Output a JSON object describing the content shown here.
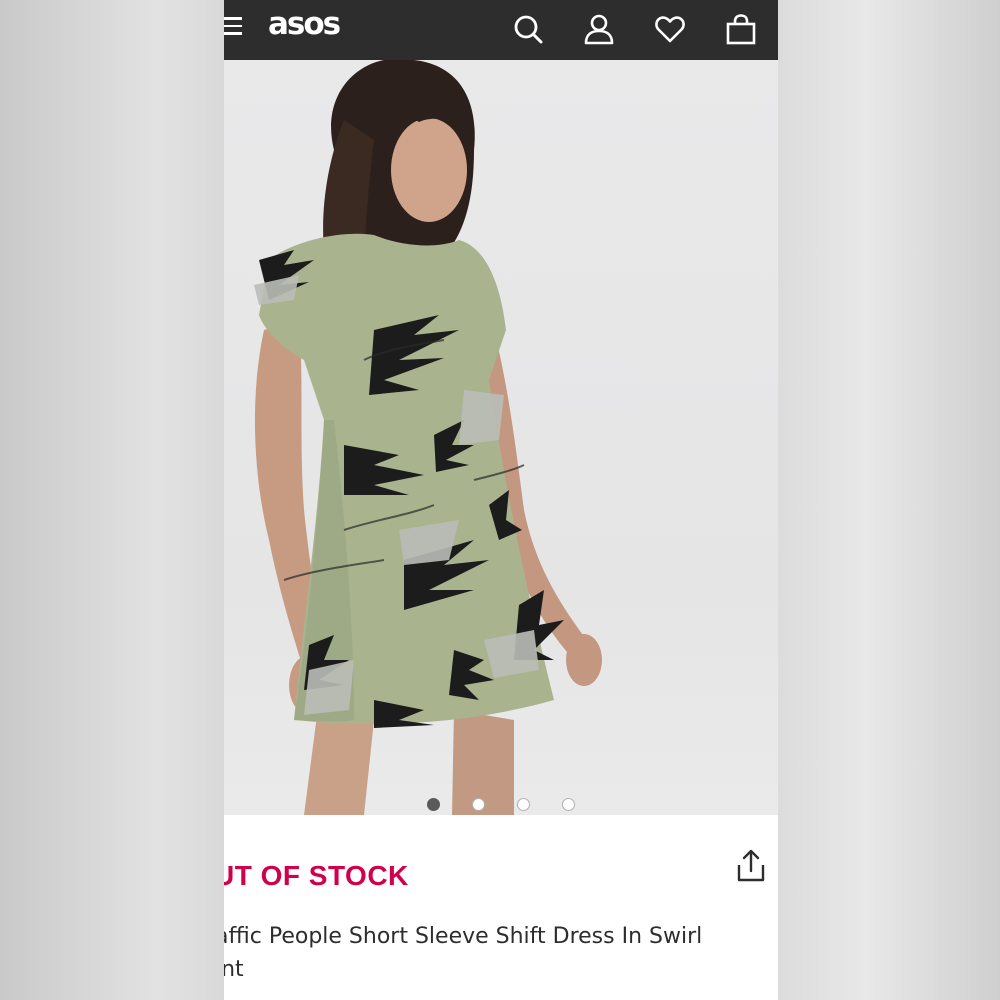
{
  "header": {
    "logo": "asos",
    "icons": [
      "menu-icon",
      "search-icon",
      "account-icon",
      "heart-icon",
      "bag-icon"
    ]
  },
  "gallery": {
    "image_count": 4,
    "active_index": 0
  },
  "product": {
    "stock_status": "UT OF STOCK",
    "title": "affic People Short Sleeve Shift Dress In Swirl int"
  },
  "colors": {
    "header_bg": "#2d2d2d",
    "stock_red": "#d1004c",
    "dress_green": "#a9b48f"
  }
}
